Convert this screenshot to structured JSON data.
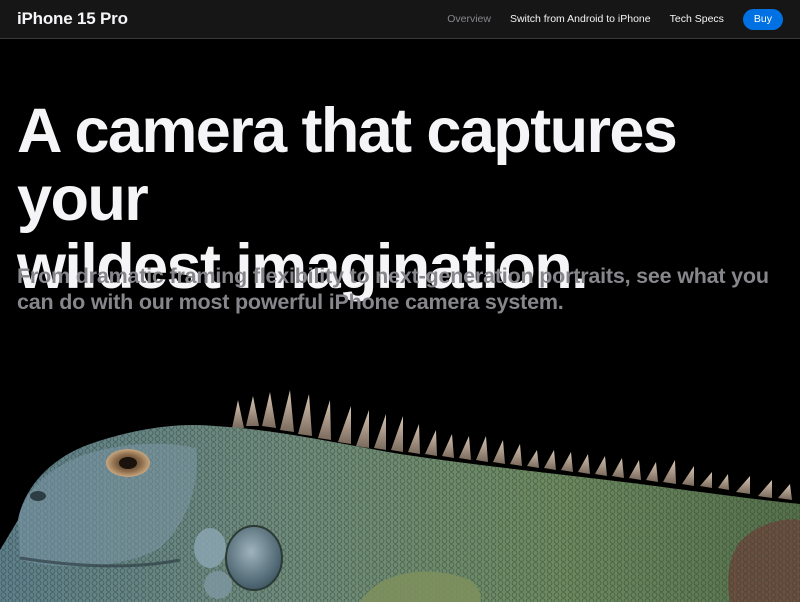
{
  "localnav": {
    "title": "iPhone 15 Pro",
    "links": [
      {
        "label": "Overview",
        "current": true
      },
      {
        "label": "Switch from Android to iPhone",
        "current": false
      },
      {
        "label": "Tech Specs",
        "current": false
      }
    ],
    "buy_label": "Buy"
  },
  "hero": {
    "headline_line1": "A camera that captures your",
    "headline_line2": "wildest imagination.",
    "subhead_line1": "From dramatic framing flexibility to next-generation portraits, see what you",
    "subhead_line2": "can do with our most powerful iPhone camera system."
  },
  "colors": {
    "background": "#000000",
    "nav_background": "#161617",
    "text_primary": "#f5f5f7",
    "text_secondary": "#86868b",
    "accent": "#0071e3"
  }
}
